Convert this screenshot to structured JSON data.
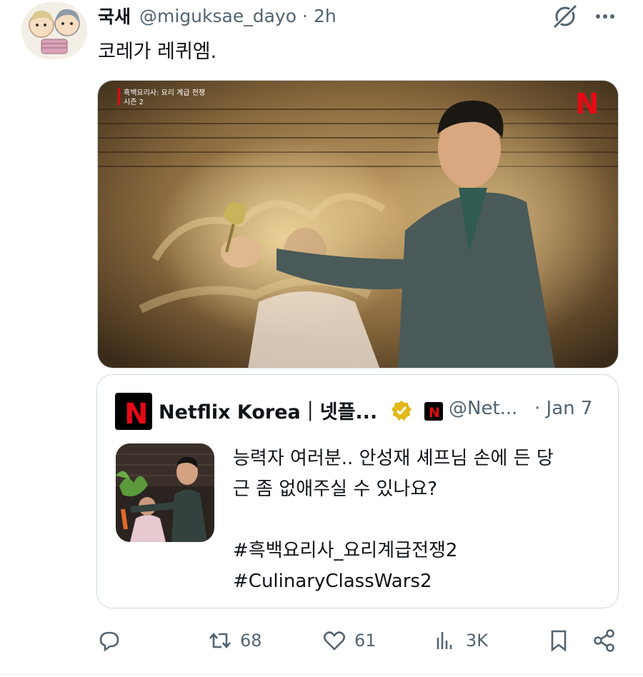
{
  "tweet": {
    "display_name": "국새",
    "handle": "@miguksae_dayo",
    "separator": "·",
    "time": "2h",
    "text": "코레가 레퀴엠."
  },
  "media": {
    "overlay_title": "흑백요리사: 요리 계급 전쟁",
    "overlay_subtitle": "시즌 2",
    "brand_mark": "N"
  },
  "quote": {
    "display_name": "Netflix Korea｜넷플...",
    "handle": "@Net...",
    "date": "· Jan 7",
    "logo_letter": "N",
    "body_line1": "능력자 여러분.. 안성재 셰프님 손에 든 당",
    "body_line2": "근 좀 없애주실 수 있나요?",
    "hashtag1": "#흑백요리사_요리계급전쟁2",
    "hashtag2": "#CulinaryClassWars2"
  },
  "actions": {
    "reply_count": "",
    "retweet_count": "68",
    "like_count": "61",
    "views_count": "3K"
  },
  "colors": {
    "text_primary": "#0f1419",
    "text_secondary": "#536471",
    "border": "#cfd9de",
    "netflix_red": "#e50914",
    "verified_gold": "#e2b719"
  }
}
